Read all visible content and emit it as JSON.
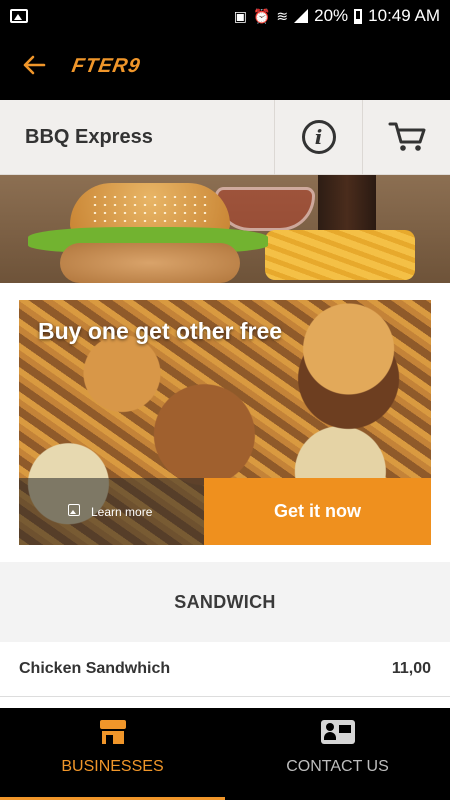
{
  "status_bar": {
    "battery": "20%",
    "time": "10:49 AM"
  },
  "app_bar": {
    "logo_text": "FTER9",
    "back_icon": "arrow-left-icon"
  },
  "store": {
    "name": "BBQ Express",
    "info_icon": "info-icon",
    "cart_icon": "cart-icon"
  },
  "promo": {
    "title": "Buy one get other free",
    "learn_more_label": "Learn more",
    "cta_label": "Get it now"
  },
  "menu": {
    "section_title": "SANDWICH",
    "items": [
      {
        "name": "Chicken Sandwhich",
        "price": "11,00"
      }
    ]
  },
  "bottom_nav": {
    "items": [
      {
        "label": "BUSINESSES",
        "icon": "store-icon",
        "active": true
      },
      {
        "label": "CONTACT US",
        "icon": "contact-card-icon",
        "active": false
      }
    ]
  },
  "colors": {
    "accent": "#f0962a",
    "cta": "#ef901e",
    "bar": "#000000"
  }
}
